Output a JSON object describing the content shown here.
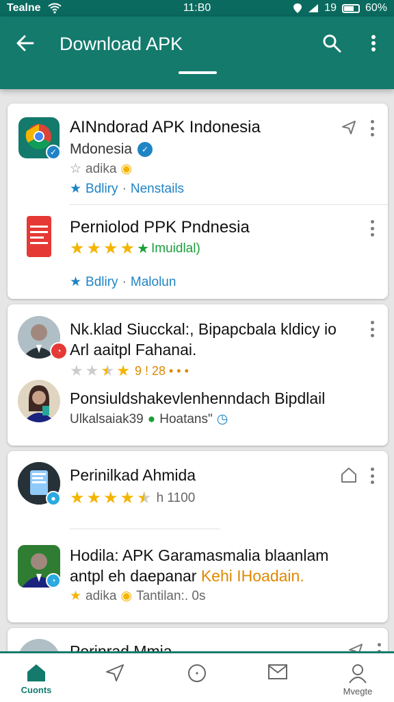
{
  "status_bar": {
    "carrier": "Tealne",
    "time": "11:B0",
    "signal_text": "19",
    "battery": "60%"
  },
  "app_bar": {
    "title": "Download APK"
  },
  "cards": [
    {
      "rows": [
        {
          "title": "AINndorad APK Indonesia",
          "subtitle": "Mdonesia",
          "meta": "adika",
          "meta2_a": "Bdliry",
          "meta2_b": "Nenstails"
        },
        {
          "title": "Perniolod PPK Pndnesia",
          "rating_note": "Imuidlal)",
          "meta_a": "Bdliry",
          "meta_b": "Malolun"
        }
      ]
    },
    {
      "rows": [
        {
          "title_line1": "Nk.klad Siucckal:, Bipapcbala kldicy io",
          "title_line2": "Arl aaitpl Fahanai.",
          "rating_text": "9 ! 28 • • •"
        },
        {
          "title": "Ponsiuldshakevlenhenndach Bipdlail",
          "meta": "Ulkalsaiak39",
          "meta2": "Hoatans\""
        }
      ]
    },
    {
      "rows": [
        {
          "title": "Perinilkad Ahmida",
          "rating_text": "h 1100"
        },
        {
          "title_line1": "Hodila: APK Garamasmalia blaanlam",
          "title_line2_a": "antpl eh daepanar",
          "title_line2_b": "Kehi IHoadain.",
          "meta_a": "adika",
          "meta_b": "Tantilan:. 0s"
        }
      ]
    },
    {
      "rows": [
        {
          "title": "Perinrad Mmia"
        }
      ]
    }
  ],
  "bottom_nav": [
    {
      "label": "Cuonts",
      "icon": "home-icon",
      "active": true
    },
    {
      "label": "",
      "icon": "send-icon",
      "active": false
    },
    {
      "label": "",
      "icon": "chat-icon",
      "active": false
    },
    {
      "label": "",
      "icon": "mail-icon",
      "active": false
    },
    {
      "label": "Mvegte",
      "icon": "profile-icon",
      "active": false
    }
  ],
  "colors": {
    "primary": "#137a6c",
    "status_bar": "#0a6a5f",
    "accent_blue": "#1f84c4",
    "star": "#f4b400",
    "rating_green": "#1a9e3a",
    "orange": "#e08800"
  }
}
